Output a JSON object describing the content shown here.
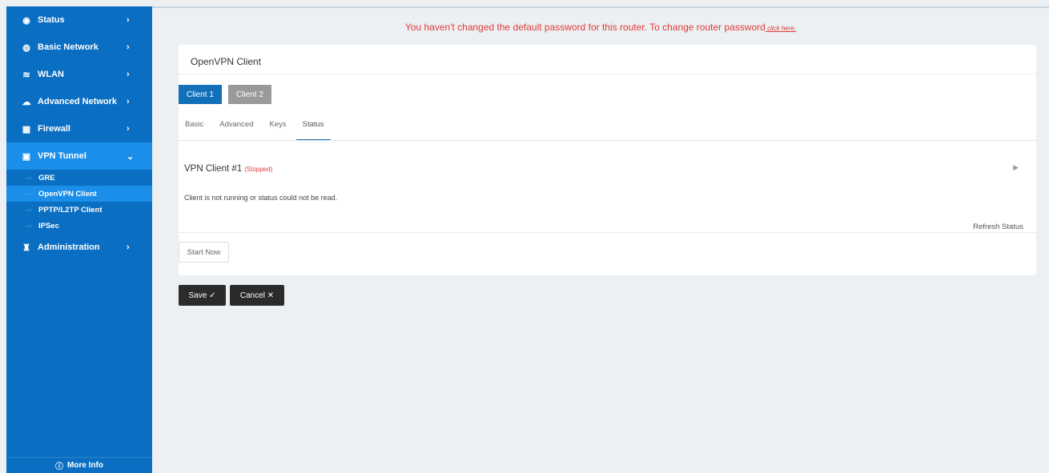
{
  "sidebar": {
    "items": [
      {
        "label": "Status",
        "icon": "eye-icon"
      },
      {
        "label": "Basic Network",
        "icon": "globe-icon"
      },
      {
        "label": "WLAN",
        "icon": "wifi-icon"
      },
      {
        "label": "Advanced Network",
        "icon": "cloud-icon"
      },
      {
        "label": "Firewall",
        "icon": "firewall-icon"
      },
      {
        "label": "VPN Tunnel",
        "icon": "vpn-icon"
      },
      {
        "label": "Administration",
        "icon": "admin-icon"
      }
    ],
    "subitems": [
      {
        "label": "GRE"
      },
      {
        "label": "OpenVPN Client"
      },
      {
        "label": "PPTP/L2TP Client"
      },
      {
        "label": "IPSec"
      }
    ],
    "more_info": "More Info",
    "accent_color": "#0a6fc2",
    "active_color": "#1b8eea"
  },
  "warning": {
    "text": "You haven't changed the default password for this router. To change router password",
    "link": " click here."
  },
  "card": {
    "title": "OpenVPN Client",
    "client_tabs": [
      "Client 1",
      "Client 2"
    ],
    "tabs": [
      "Basic",
      "Advanced",
      "Keys",
      "Status"
    ],
    "vpn_title": "VPN Client #1",
    "vpn_state": "(Stopped)",
    "message": "Client is not running or status could not be read.",
    "refresh": "Refresh Status",
    "start": "Start Now"
  },
  "actions": {
    "save": "Save ✓",
    "cancel": "Cancel ✕"
  }
}
